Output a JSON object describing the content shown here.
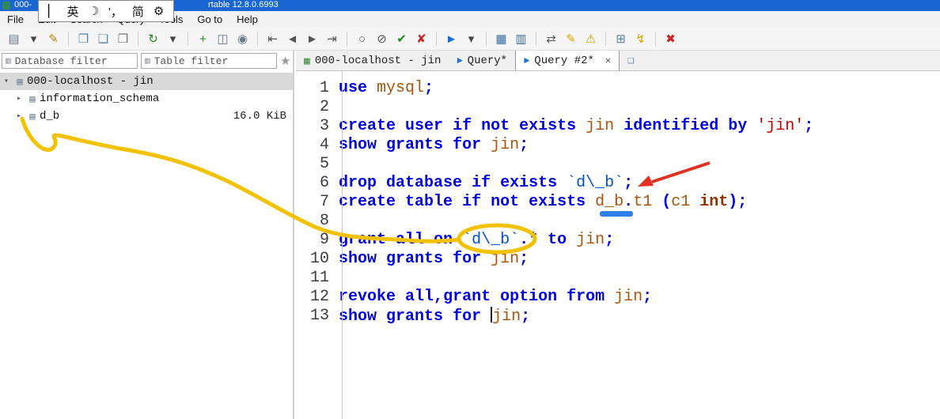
{
  "colors": {
    "titlebar": "#1966D2",
    "kw": "#0000E0",
    "id": "#A8540A",
    "str": "#C00000",
    "bq": "#0050D0",
    "type": "#993000",
    "yellow": "#F2C100",
    "red": "#E03222",
    "underline": "#2F7FE8",
    "toolbar_blue": "#1a6fd4"
  },
  "titlebar": {
    "left_text": "000-",
    "right_text": "rtable 12.8.0.6993"
  },
  "ime": {
    "items": [
      {
        "name": "ime-caret",
        "glyph": "▏"
      },
      {
        "name": "ime-lang-mode",
        "glyph": "英"
      },
      {
        "name": "ime-moon-icon",
        "glyph": "☽"
      },
      {
        "name": "ime-punct-mode",
        "glyph": "'，"
      },
      {
        "name": "ime-charset-mode",
        "glyph": "简"
      },
      {
        "name": "ime-settings-icon",
        "glyph": "⚙"
      }
    ]
  },
  "menu": {
    "items": [
      "File",
      "Edit",
      "Search",
      "Query",
      "Tools",
      "Go to",
      "Help"
    ]
  },
  "toolbar": {
    "icons": [
      {
        "name": "session-icon",
        "glyph": "▤",
        "color": "#6b7a8c"
      },
      {
        "name": "session-dropdown-icon",
        "glyph": "▾",
        "color": "#444444"
      },
      {
        "name": "edit-session-icon",
        "glyph": "✎",
        "color": "#b8860b"
      },
      {
        "sep": true
      },
      {
        "name": "copy-icon",
        "glyph": "❐",
        "color": "#5b7fa6"
      },
      {
        "name": "paste-icon",
        "glyph": "❏",
        "color": "#5b7fa6"
      },
      {
        "name": "print-icon",
        "glyph": "❒",
        "color": "#777777"
      },
      {
        "sep": true
      },
      {
        "name": "refresh-icon",
        "glyph": "↻",
        "color": "#1f8a1f"
      },
      {
        "name": "refresh-dropdown-icon",
        "glyph": "▾",
        "color": "#444444"
      },
      {
        "sep": true
      },
      {
        "name": "add-record-icon",
        "glyph": "+",
        "color": "#1f8a1f"
      },
      {
        "name": "user-manager-icon",
        "glyph": "◫",
        "color": "#6b7a8c"
      },
      {
        "name": "web-search-icon",
        "glyph": "◉",
        "color": "#6b7a8c"
      },
      {
        "sep": true
      },
      {
        "name": "first-row-icon",
        "glyph": "⇤",
        "color": "#555555"
      },
      {
        "name": "prev-row-icon",
        "glyph": "◄",
        "color": "#555555"
      },
      {
        "name": "next-row-icon",
        "glyph": "►",
        "color": "#555555"
      },
      {
        "name": "last-row-icon",
        "glyph": "⇥",
        "color": "#555555"
      },
      {
        "sep": true
      },
      {
        "name": "record-icon",
        "glyph": "○",
        "color": "#555555"
      },
      {
        "name": "cancel-circle-icon",
        "glyph": "⊘",
        "color": "#555555"
      },
      {
        "name": "apply-check-icon",
        "glyph": "✔",
        "color": "#1f8a1f"
      },
      {
        "name": "discard-x-icon",
        "glyph": "✘",
        "color": "#cc2222"
      },
      {
        "sep": true
      },
      {
        "name": "run-query-icon",
        "glyph": "►",
        "color": "#1a6fd4"
      },
      {
        "name": "run-dropdown-icon",
        "glyph": "▾",
        "color": "#444444"
      },
      {
        "sep": true
      },
      {
        "name": "save-icon",
        "glyph": "▦",
        "color": "#3a6ea5"
      },
      {
        "name": "open-file-icon",
        "glyph": "▥",
        "color": "#3a6ea5"
      },
      {
        "sep": true
      },
      {
        "name": "find-replace-icon",
        "glyph": "⇄",
        "color": "#555555"
      },
      {
        "name": "format-code-icon",
        "glyph": "✎",
        "color": "#d9a400"
      },
      {
        "name": "warning-icon",
        "glyph": "⚠",
        "color": "#d9a400"
      },
      {
        "sep": true
      },
      {
        "name": "snippet-icon",
        "glyph": "⊞",
        "color": "#5b7fa6"
      },
      {
        "name": "lightning-icon",
        "glyph": "↯",
        "color": "#d9a400"
      },
      {
        "sep": true
      },
      {
        "name": "stop-icon",
        "glyph": "✖",
        "color": "#cc2222"
      }
    ]
  },
  "sidebar": {
    "database_filter": "Database filter",
    "table_filter": "Table filter",
    "filter_icon": "▥",
    "star_icon": "★",
    "tree": [
      {
        "arrow": "▾",
        "icon_glyph": "▤",
        "label": "000-localhost - jin"
      },
      {
        "arrow": "▸",
        "icon_glyph": "▤",
        "label": "information_schema"
      },
      {
        "arrow": "▸",
        "icon_glyph": "▤",
        "label": "d_b",
        "size": "16.0 KiB"
      }
    ]
  },
  "tabs": {
    "grid_glyph": "▦",
    "play_glyph": "►",
    "close_glyph": "✕",
    "newtab_glyph": "❏",
    "items": [
      {
        "label": "000-localhost - jin"
      },
      {
        "label": "Query*"
      },
      {
        "label": "Query #2*"
      }
    ]
  },
  "editor": {
    "lines": [
      [
        [
          "kw",
          "use"
        ],
        [
          "pl",
          " "
        ],
        [
          "id",
          "mysql"
        ],
        [
          "pun",
          ";"
        ]
      ],
      [],
      [
        [
          "kw",
          "create"
        ],
        [
          "pl",
          " "
        ],
        [
          "kw",
          "user"
        ],
        [
          "pl",
          " "
        ],
        [
          "kw",
          "if"
        ],
        [
          "pl",
          " "
        ],
        [
          "kw",
          "not"
        ],
        [
          "pl",
          " "
        ],
        [
          "kw",
          "exists"
        ],
        [
          "pl",
          " "
        ],
        [
          "id",
          "jin"
        ],
        [
          "pl",
          " "
        ],
        [
          "kw",
          "identified"
        ],
        [
          "pl",
          " "
        ],
        [
          "kw",
          "by"
        ],
        [
          "pl",
          " "
        ],
        [
          "str",
          "'jin'"
        ],
        [
          "pun",
          ";"
        ]
      ],
      [
        [
          "kw",
          "show"
        ],
        [
          "pl",
          " "
        ],
        [
          "kw",
          "grants"
        ],
        [
          "pl",
          " "
        ],
        [
          "kw",
          "for"
        ],
        [
          "pl",
          " "
        ],
        [
          "id",
          "jin"
        ],
        [
          "pun",
          ";"
        ]
      ],
      [],
      [
        [
          "kw",
          "drop"
        ],
        [
          "pl",
          " "
        ],
        [
          "kw",
          "database"
        ],
        [
          "pl",
          " "
        ],
        [
          "kw",
          "if"
        ],
        [
          "pl",
          " "
        ],
        [
          "kw",
          "exists"
        ],
        [
          "pl",
          " "
        ],
        [
          "bq",
          "`d\\_b`"
        ],
        [
          "pun",
          ";"
        ]
      ],
      [
        [
          "kw",
          "create"
        ],
        [
          "pl",
          " "
        ],
        [
          "kw",
          "table"
        ],
        [
          "pl",
          " "
        ],
        [
          "kw",
          "if"
        ],
        [
          "pl",
          " "
        ],
        [
          "kw",
          "not"
        ],
        [
          "pl",
          " "
        ],
        [
          "kw",
          "exists"
        ],
        [
          "pl",
          " "
        ],
        [
          "id",
          "d_b"
        ],
        [
          "pun",
          "."
        ],
        [
          "id",
          "t1"
        ],
        [
          "pun",
          " ("
        ],
        [
          "id",
          "c1"
        ],
        [
          "pl",
          " "
        ],
        [
          "type",
          "int"
        ],
        [
          "pun",
          ")"
        ],
        [
          "pun",
          ";"
        ]
      ],
      [],
      [
        [
          "kw",
          "grant"
        ],
        [
          "pl",
          " "
        ],
        [
          "kw",
          "all"
        ],
        [
          "pl",
          " "
        ],
        [
          "kw",
          "on"
        ],
        [
          "pl",
          " "
        ],
        [
          "bq",
          "`d\\_b`"
        ],
        [
          "pun",
          ".*"
        ],
        [
          "pl",
          " "
        ],
        [
          "kw",
          "to"
        ],
        [
          "pl",
          " "
        ],
        [
          "id",
          "jin"
        ],
        [
          "pun",
          ";"
        ]
      ],
      [
        [
          "kw",
          "show"
        ],
        [
          "pl",
          " "
        ],
        [
          "kw",
          "grants"
        ],
        [
          "pl",
          " "
        ],
        [
          "kw",
          "for"
        ],
        [
          "pl",
          " "
        ],
        [
          "id",
          "jin"
        ],
        [
          "pun",
          ";"
        ]
      ],
      [],
      [
        [
          "kw",
          "revoke"
        ],
        [
          "pl",
          " "
        ],
        [
          "kw",
          "all"
        ],
        [
          "pun",
          ","
        ],
        [
          "kw",
          "grant"
        ],
        [
          "pl",
          " "
        ],
        [
          "kw",
          "option"
        ],
        [
          "pl",
          " "
        ],
        [
          "kw",
          "from"
        ],
        [
          "pl",
          " "
        ],
        [
          "id",
          "jin"
        ],
        [
          "pun",
          ";"
        ]
      ],
      [
        [
          "kw",
          "show"
        ],
        [
          "pl",
          " "
        ],
        [
          "kw",
          "grants"
        ],
        [
          "pl",
          " "
        ],
        [
          "kw",
          "for"
        ],
        [
          "pl",
          " "
        ],
        [
          "caret",
          ""
        ],
        [
          "id",
          "jin"
        ],
        [
          "pun",
          ";"
        ]
      ]
    ]
  }
}
